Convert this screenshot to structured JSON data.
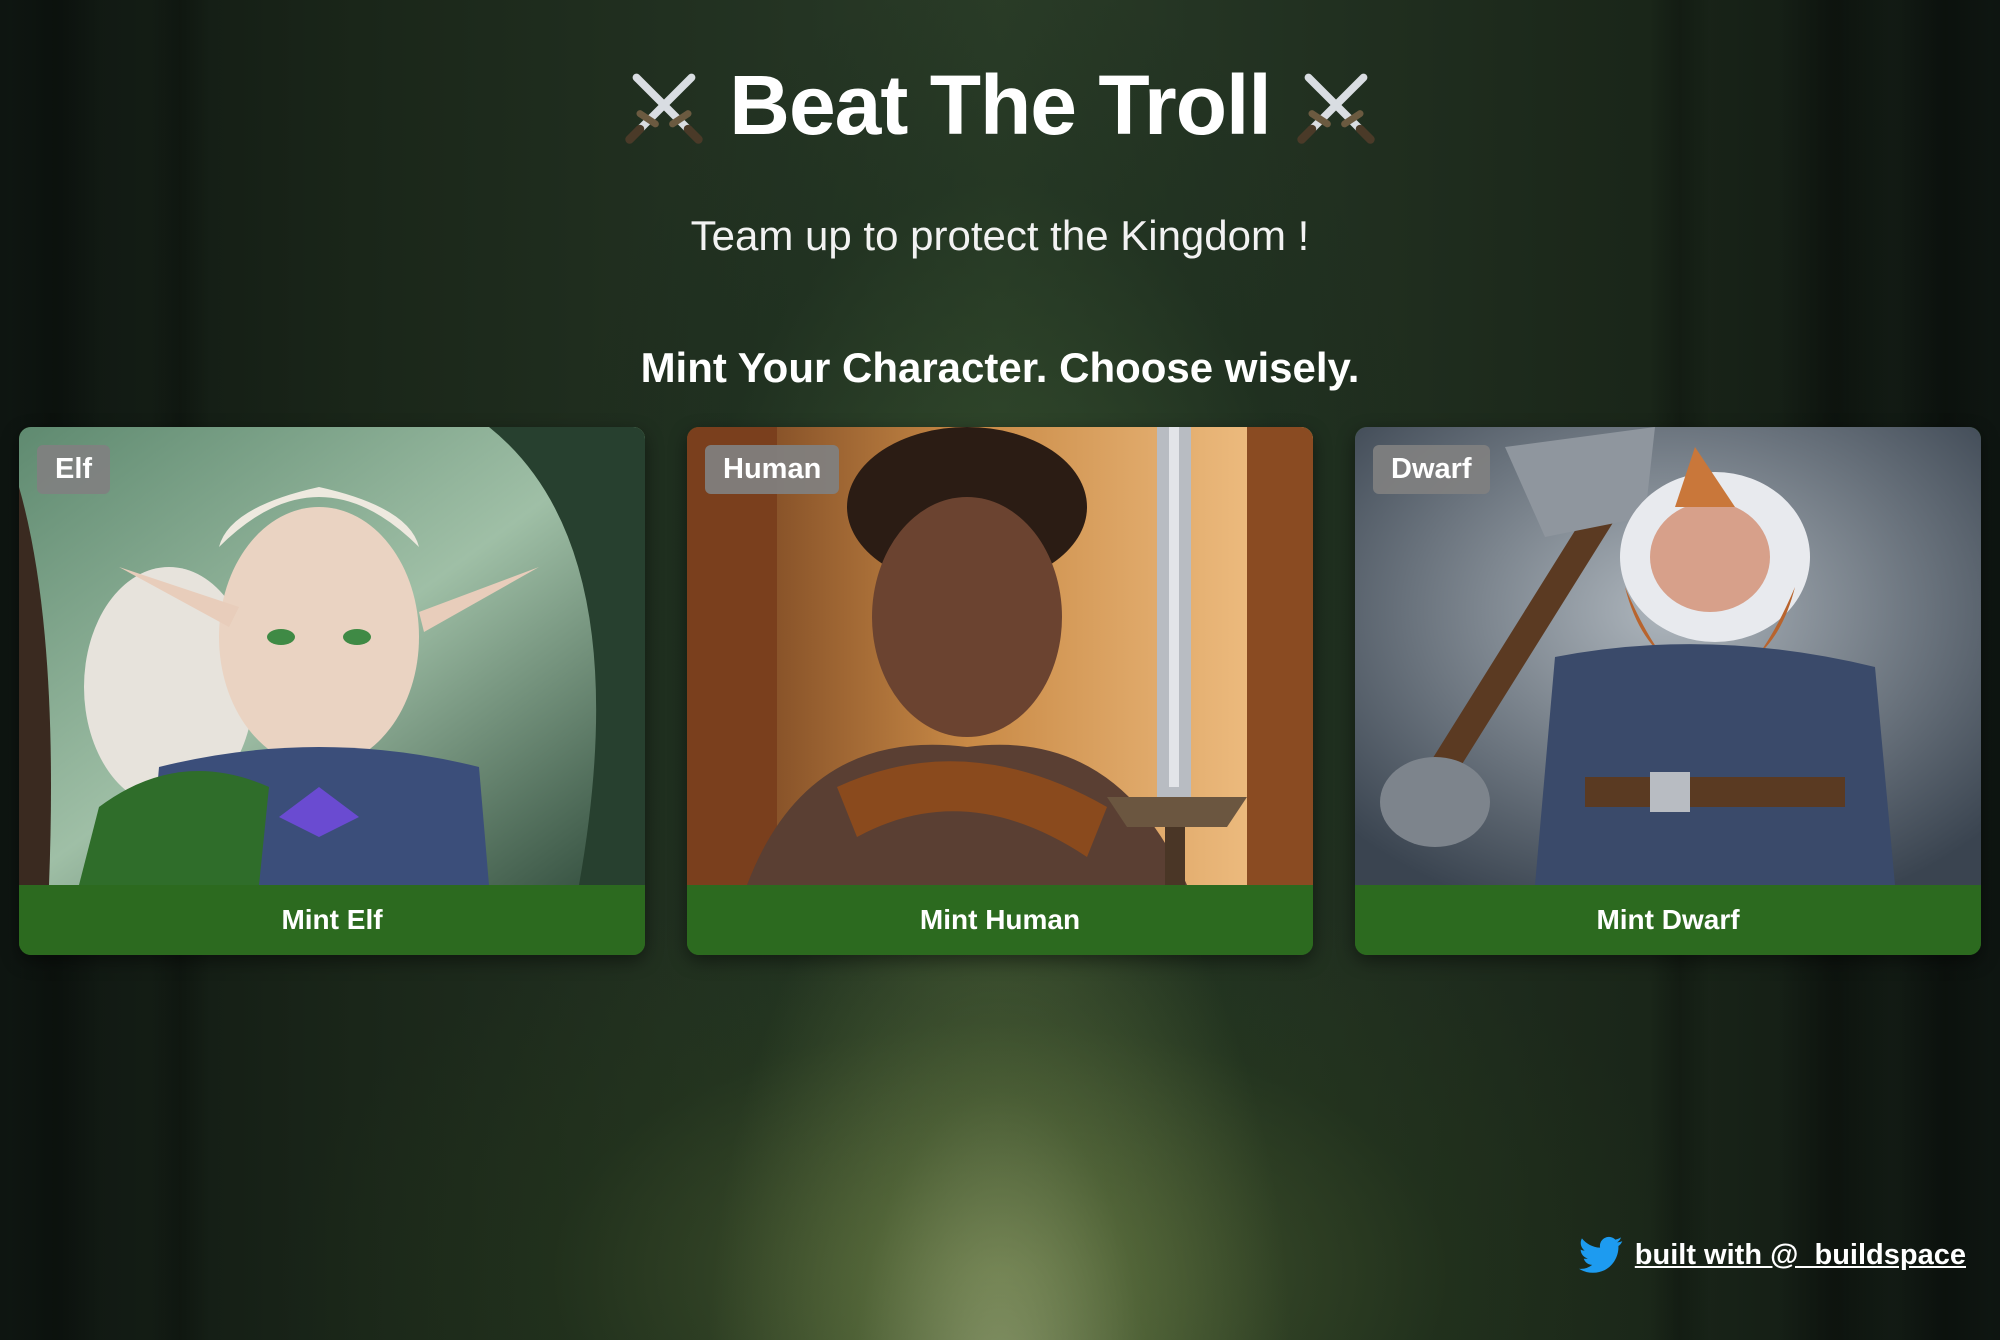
{
  "header": {
    "title": "Beat The Troll",
    "title_icon": "crossed-swords-icon",
    "subtitle": "Team up to protect the Kingdom !"
  },
  "mint_section": {
    "heading": "Mint Your Character. Choose wisely."
  },
  "characters": [
    {
      "badge": "Elf",
      "button_label": "Mint Elf"
    },
    {
      "badge": "Human",
      "button_label": "Mint Human"
    },
    {
      "badge": "Dwarf",
      "button_label": "Mint Dwarf"
    }
  ],
  "footer": {
    "icon": "twitter-icon",
    "link_text": "built with @_buildspace"
  },
  "colors": {
    "button_green": "#2c6a1f",
    "badge_gray": "#808080",
    "twitter_blue": "#1d9bf0"
  }
}
